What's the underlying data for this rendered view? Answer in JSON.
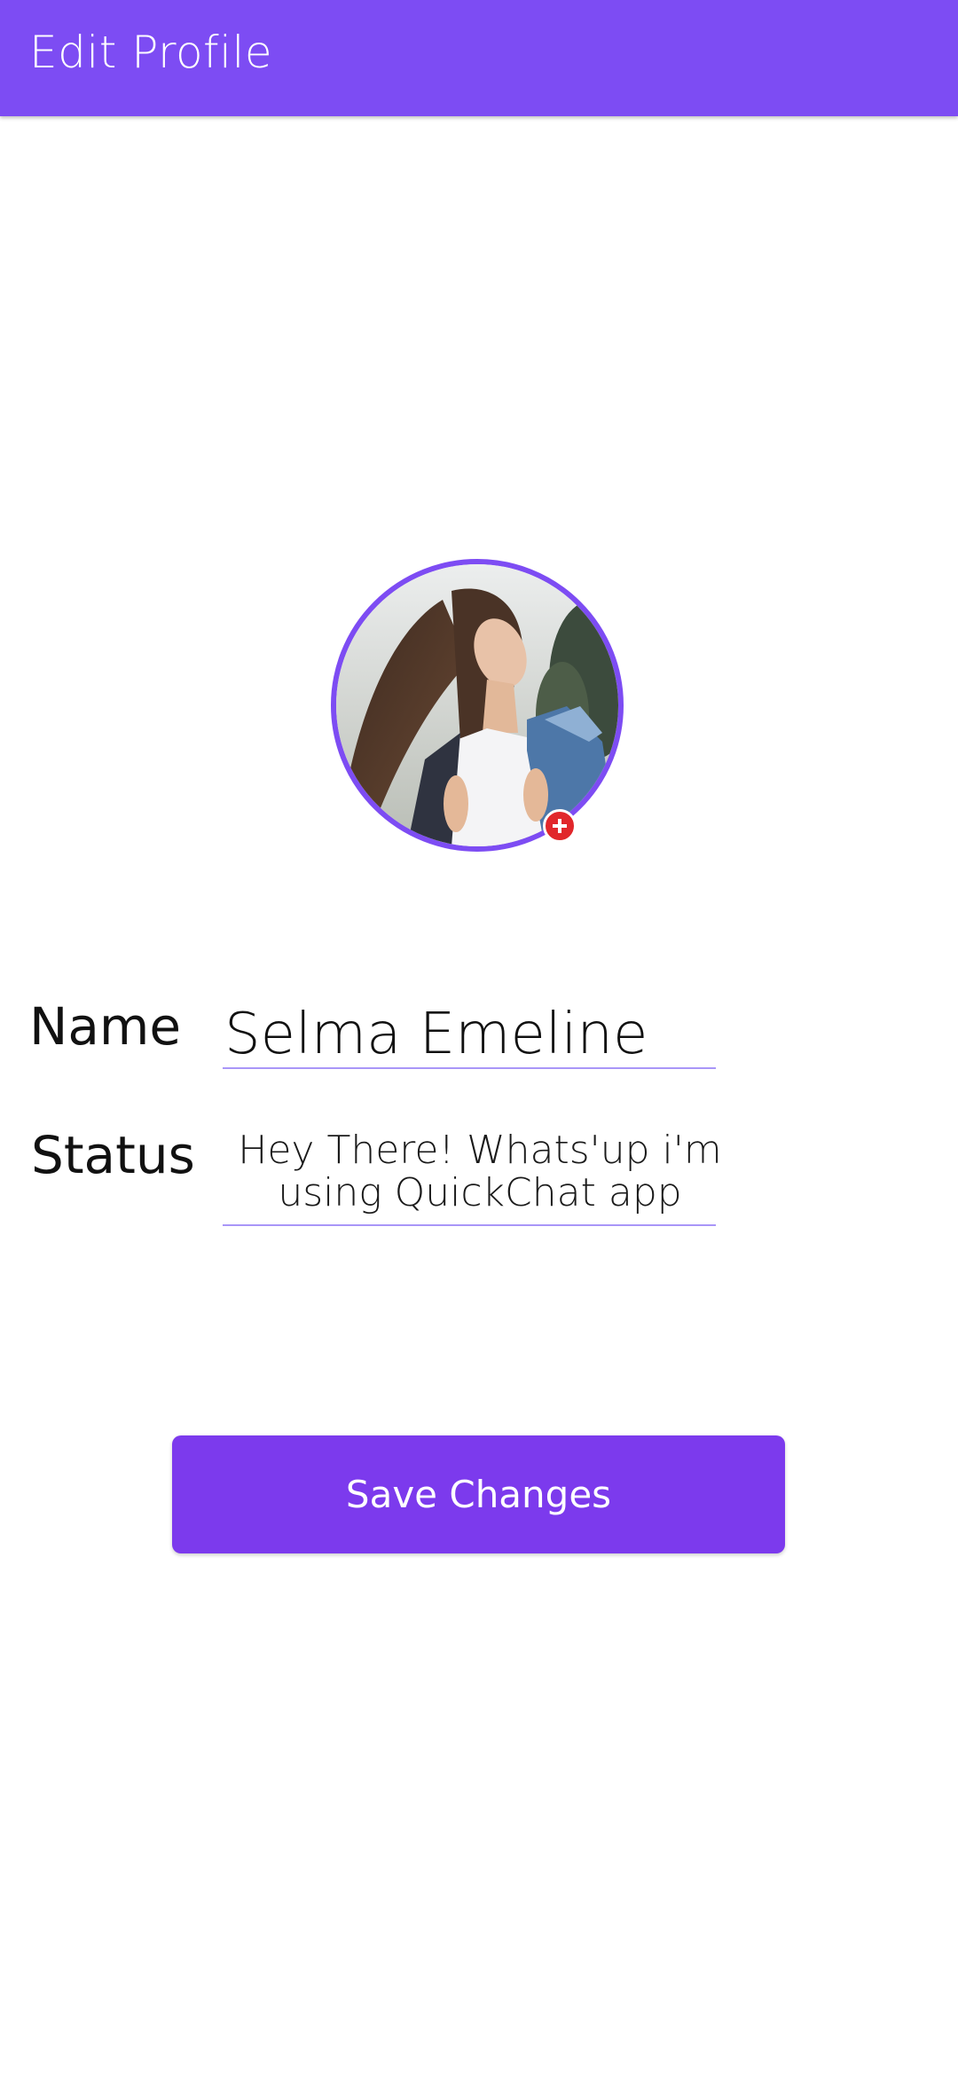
{
  "appbar": {
    "title": "Edit Profile",
    "color": "#7d4cf3"
  },
  "avatar": {
    "add_icon": "plus-circle-icon",
    "ring_color": "#7d4cf3",
    "badge_color": "#e1272b"
  },
  "form": {
    "name_label": "Name",
    "name_value": "Selma Emeline",
    "status_label": "Status",
    "status_value": "Hey There! Whats'up i'm using QuickChat app"
  },
  "actions": {
    "save_label": "Save Changes",
    "button_color": "#7c3aed"
  }
}
